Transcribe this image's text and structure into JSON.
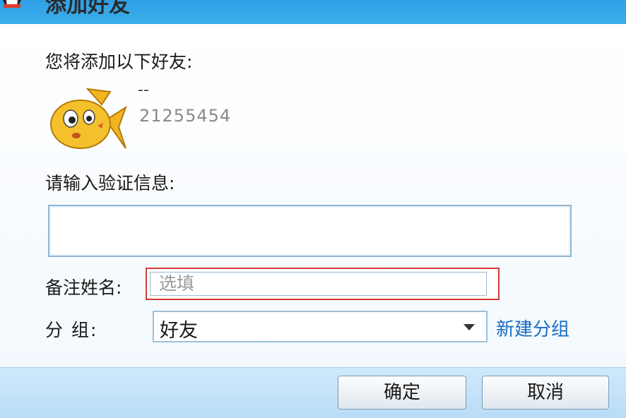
{
  "window": {
    "title": "添加好友",
    "accent_color": "#37a8e8"
  },
  "intro": {
    "text": "您将添加以下好友:"
  },
  "friend": {
    "nickname": "--",
    "qq_number": "21255454",
    "avatar_icon": "goldfish-avatar-icon"
  },
  "verify": {
    "label": "请输入验证信息:",
    "value": ""
  },
  "remark": {
    "label": "备注姓名:",
    "value": "",
    "placeholder": "选填",
    "highlight_color": "#d33a3a"
  },
  "group": {
    "label": "分  组:",
    "selected": "好友",
    "new_group_link": "新建分组"
  },
  "buttons": {
    "ok": "确定",
    "cancel": "取消"
  }
}
